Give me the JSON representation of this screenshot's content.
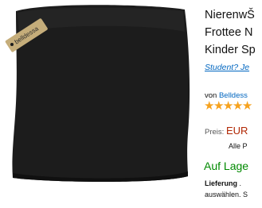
{
  "product": {
    "image_alt": "Black fleece kidney warmer tube with hang tag",
    "tag_text": "belldessa",
    "title_lines": [
      "NierenwŠ",
      "Frottee N",
      "Kinder Sp"
    ],
    "student_link": "Student? Je",
    "brand_prefix": "von",
    "brand_link": "Belldess",
    "rating_stars": 4.5,
    "price_label": "Preis:",
    "price_value": "EUR",
    "shipping_note": "Alle P",
    "availability": "Auf Lage",
    "delivery_label": "Lieferung",
    "delivery_rest": ".",
    "delivery_line2": "auswählen. S"
  },
  "colors": {
    "link": "#0066c0",
    "price": "#b12704",
    "stock": "#008a00",
    "star": "#f6a21e"
  }
}
